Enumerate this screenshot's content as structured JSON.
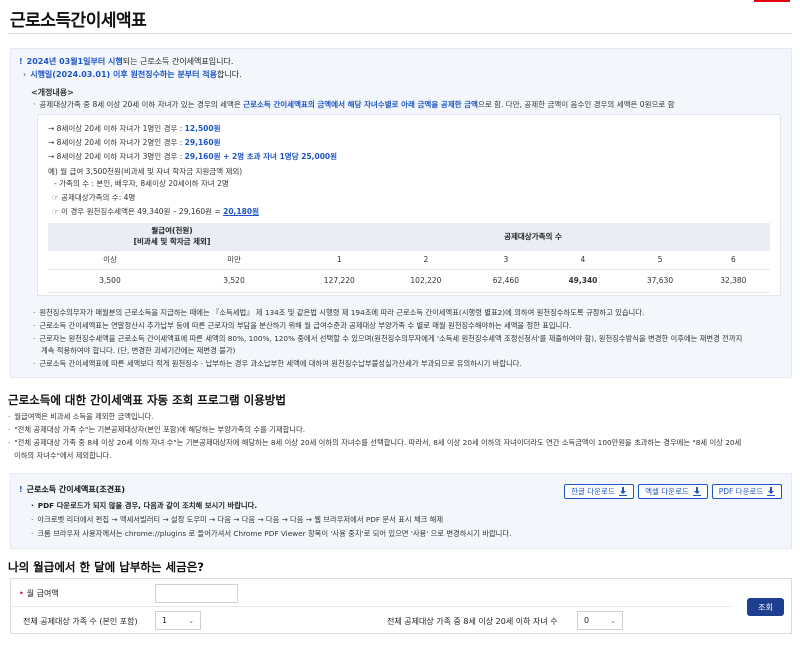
{
  "page_title": "근로소득간이세액표",
  "notice": {
    "line1_blue": "2024년 03월1일부터 시행",
    "line1_rest": "되는 근로소득 간이세액표입니다.",
    "line2_blue": "시행일(2024.03.01) 이후 원천징수하는 분부터 적용",
    "line2_rest": "합니다.",
    "sub_heading": "<개정내용>",
    "bullet1_pre": "공제대상가족 중 8세 이상 20세 이하 자녀가 있는 경우의 세액은 ",
    "bullet1_blue": "근로소득 간이세액표의 금액에서 해당 자녀수별로 아래 금액을 공제한 금액",
    "bullet1_post": "으로 함. 다만, 공제한 금액이 음수인 경우의 세액은 0원으로 함",
    "rules": [
      {
        "pre": "→ 8세이상 20세 이하 자녀가 1명인 경우 : ",
        "blue": "12,500원"
      },
      {
        "pre": "→ 8세이상 20세 이하 자녀가 2명인 경우 : ",
        "blue": "29,160원"
      },
      {
        "pre": "→ 8세이상 20세 이하 자녀가 3명인 경우 : ",
        "blue": "29,160원 + 2명 초과 자녀 1명당 25,000원"
      }
    ],
    "example_line": "예) 월 급여 3,500천원(비과세 및 자녀 학자금 지원금액 제외)",
    "family_line": "- 가족의 수 : 본인, 배우자, 8세이상 20세이하 자녀 2명",
    "deduct_count": "☞ 공제대상가족의 수: 4명",
    "result_pre": "☞ 이 경우 원천징수세액은 49,340원 – 29,160원 = ",
    "result_value": "20,180원",
    "table": {
      "salary_header": "월급여(천원)",
      "salary_sub": "[비과세 및 학자금 제외]",
      "family_header": "공제대상가족의 수",
      "sub_headers": [
        "이상",
        "미만",
        "1",
        "2",
        "3",
        "4",
        "5",
        "6"
      ],
      "row": [
        "3,500",
        "3,520",
        "127,220",
        "102,220",
        "62,460",
        "49,340",
        "37,630",
        "32,380"
      ]
    },
    "notes": [
      "원천징수의무자가 매월분의 근로소득을 지급하는 때에는 『소득세법』 제 134조 및 같은법 시행령 제 194조에 따라 근로소득 간이세액표(시행령 별표2)에 의하여 원천징수하도록 규정하고 있습니다.",
      "근로소득 간이세액표는 연말정산시 추가납부 등에 따른 근로자의 부담을 분산하기 위해 월 급여수준과 공제대상 부양가족 수 별로 매월 원천징수해야하는 세액을 정한 표입니다.",
      "근로자는 원천징수세액을 근로소득 간이세액표에 따른 세액의 80%, 100%, 120% 중에서 선택할 수 있으며(원천징수의무자에게 '소득세 원천징수세액 조정신청서'를 제출하여야 함), 원천징수방식을 변경한 이후에는 재변경 전까지",
      "계속 적용하여야 합니다. (단, 변경한 과세기간에는 재변경 불가)",
      "근로소득 간이세액표에 따른 세액보다 적게 원천징수 · 납부하는 경우 과소납부한 세액에 대하여 원천징수납부불성실가산세가 부과되므로 유의하시기 바랍니다."
    ]
  },
  "usage": {
    "title": "근로소득에 대한 간이세액표 자동 조회 프로그램 이용방법",
    "items": [
      "월급여액은  비과세 소득을 제외한 금액입니다.",
      "\"전체 공제대상 가족 수\"는 기본공제대상자(본인 포함)에 해당하는 부양가족의 수를 기재합니다.",
      "\"전체 공제대상 가족 중 8세 이상 20세 이하 자녀 수\"는 기본공제대상자에 해당하는 8세 이상 20세 이하의 자녀수를 선택합니다. 따라서, 8세 이상 20세 이하의 자녀이더라도 연간 소득금액이 100만원을 초과하는 경우에는 \"8세 이상 20세",
      "이하의 자녀수\"에서 제외합니다."
    ]
  },
  "download": {
    "title": "근로소득 간이세액표(조견표)",
    "lines": [
      "PDF 다운로드가 되지 않을 경우, 다음과 같이 조치해 보시기 바랍니다.",
      "아크로벳 리더에서 편집 → 액세서빌러티 → 설정 도우미 → 다음 → 다음 → 다음 → 다음 → 웹 브라우저에서 PDF 문서 표시 체크 해제",
      "크롬 브라우저 사용자께서는 chrome://plugins 로 들어가셔서 Chrome PDF Viewer 항목이 '사용 중지'로 되어 있으면 '사용' 으로 변경하시기 바랍니다."
    ],
    "buttons": [
      "한글 다운로드",
      "엑셀 다운로드",
      "PDF 다운로드"
    ]
  },
  "form": {
    "title": "나의 월급에서 한 달에 납부하는 세금은?",
    "salary_label": "월 급여액",
    "salary_value": "",
    "family_label": "전체 공제대상 가족 수 (본인 포함)",
    "family_value": "1",
    "children_label": "전체 공제대상 가족 중 8세 이상 20세 이하 자녀 수",
    "children_value": "0",
    "search_label": "조회"
  },
  "colors": {
    "accent": "#1d55c4",
    "button": "#1e3f8f",
    "panel_bg": "#f3f6fb",
    "brand_red": "#e60012"
  }
}
